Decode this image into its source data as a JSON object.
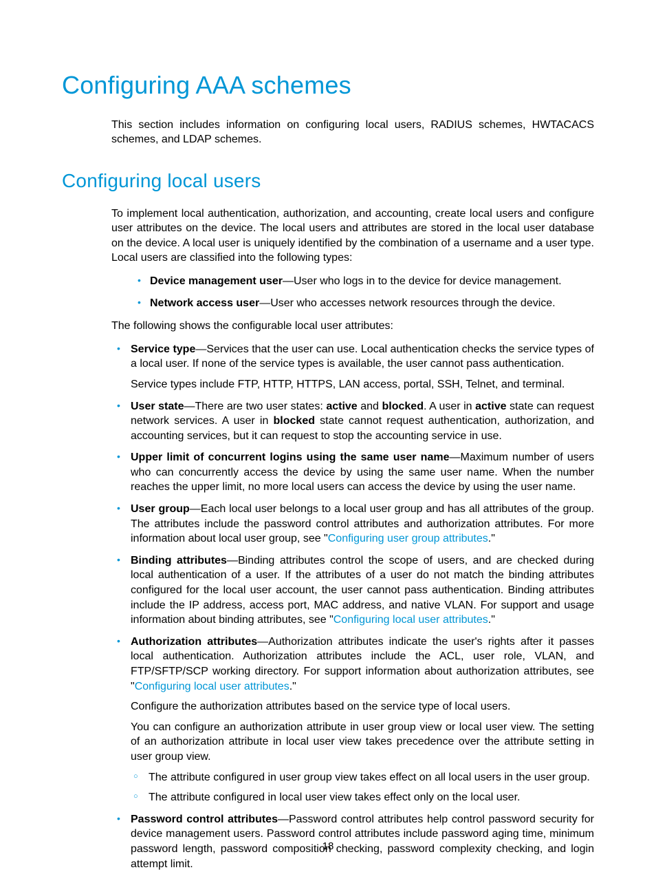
{
  "page_number": "18",
  "h1": "Configuring AAA schemes",
  "intro": "This section includes information on configuring local users, RADIUS schemes, HWTACACS schemes, and LDAP schemes.",
  "h2": "Configuring local users",
  "p_localusers": "To implement local authentication, authorization, and accounting, create local users and configure user attributes on the device. The local users and attributes are stored in the local user database on the device. A local user is uniquely identified by the combination of a username and a user type. Local users are classified into the following types:",
  "types": {
    "dmu_bold": "Device management user",
    "dmu_rest": "—User who logs in to the device for device management.",
    "nau_bold": "Network access user",
    "nau_rest": "—User who accesses network resources through the device."
  },
  "p_attrs_lead": "The following shows the configurable local user attributes:",
  "attrs": {
    "service_type": {
      "bold": "Service type",
      "rest": "—Services that the user can use. Local authentication checks the service types of a local user. If none of the service types is available, the user cannot pass authentication.",
      "para2": "Service types include FTP, HTTP, HTTPS, LAN access, portal, SSH, Telnet, and terminal."
    },
    "user_state": {
      "bold": "User state",
      "seg1": "—There are two user states: ",
      "active1": "active",
      "seg2": " and ",
      "blocked1": "blocked",
      "seg3": ". A user in ",
      "active2": "active",
      "seg4": " state can request network services. A user in ",
      "blocked2": "blocked",
      "seg5": " state cannot request authentication, authorization, and accounting services, but it can request to stop the accounting service in use."
    },
    "upper_limit": {
      "bold": "Upper limit of concurrent logins using the same user name",
      "rest": "—Maximum number of users who can concurrently access the device by using the same user name. When the number reaches the upper limit, no more local users can access the device by using the user name."
    },
    "user_group": {
      "bold": "User group",
      "rest1": "—Each local user belongs to a local user group and has all attributes of the group. The attributes include the password control attributes and authorization attributes. For more information about local user group, see \"",
      "link": "Configuring user group attributes",
      "rest2": ".\""
    },
    "binding": {
      "bold": "Binding attributes",
      "rest1": "—Binding attributes control the scope of users, and are checked during local authentication of a user. If the attributes of a user do not match the binding attributes configured for the local user account, the user cannot pass authentication. Binding attributes include the IP address, access port, MAC address, and native VLAN. For support and usage information about binding attributes, see \"",
      "link": "Configuring local user attributes",
      "rest2": ".\""
    },
    "authz": {
      "bold": "Authorization attributes",
      "rest1": "—Authorization attributes indicate the user's rights after it passes local authentication. Authorization attributes include the ACL, user role, VLAN, and FTP/SFTP/SCP working directory. For support information about authorization attributes, see \"",
      "link": "Configuring local user attributes",
      "rest2": ".\"",
      "para2": "Configure the authorization attributes based on the service type of local users.",
      "para3": "You can configure an authorization attribute in user group view or local user view. The setting of an authorization attribute in local user view takes precedence over the attribute setting in user group view.",
      "sub1": "The attribute configured in user group view takes effect on all local users in the user group.",
      "sub2": "The attribute configured in local user view takes effect only on the local user."
    },
    "pwd_ctrl": {
      "bold": "Password control attributes",
      "rest": "—Password control attributes help control password security for device management users. Password control attributes include password aging time, minimum password length, password composition checking, password complexity checking, and login attempt limit."
    }
  }
}
